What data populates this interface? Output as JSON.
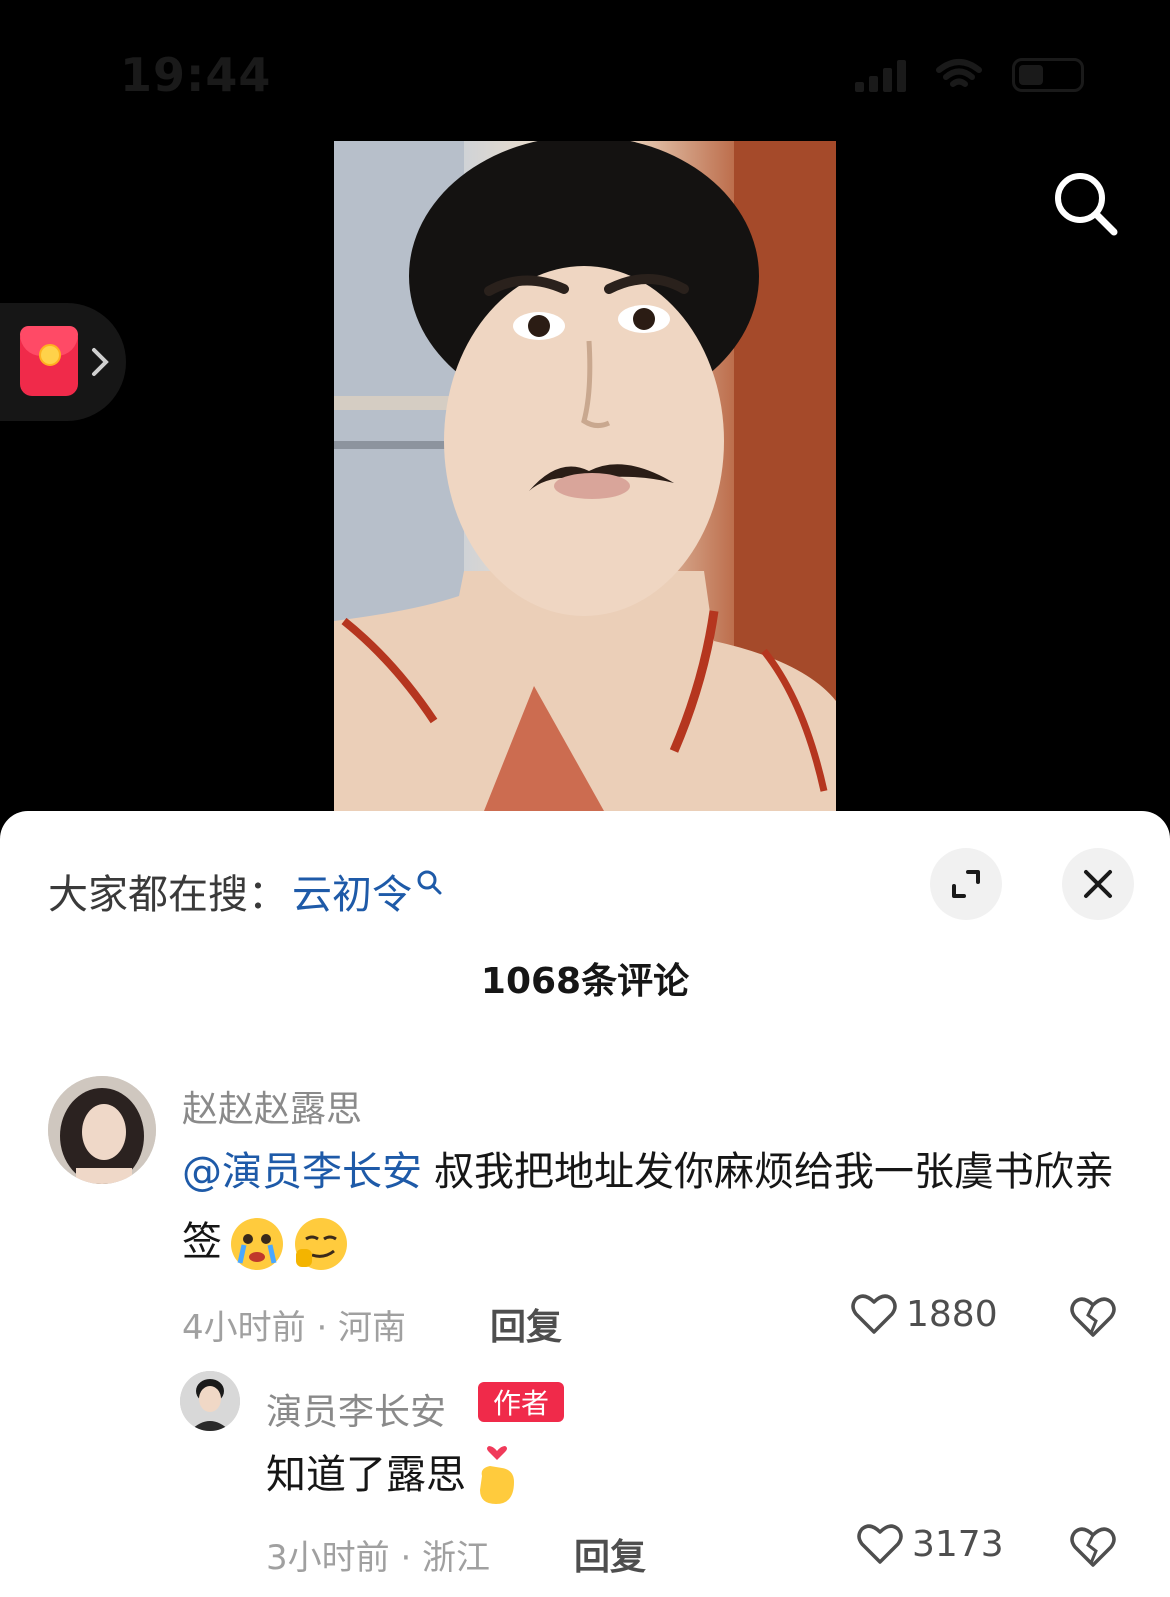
{
  "status_bar": {
    "time": "19:44"
  },
  "video": {
    "description_icon": "video-frame"
  },
  "comments_sheet": {
    "search_suggest": {
      "prefix": "大家都在搜：",
      "term": "云初令"
    },
    "comment_count_label": "1068条评论",
    "comments": [
      {
        "username": "赵赵赵露思",
        "mention": "@演员李长安",
        "text": "叔我把地址发你麻烦给我一张虞书欣亲签",
        "time_location": "4小时前 · 河南",
        "reply_label": "回复",
        "likes": "1880"
      },
      {
        "username": "演员李长安",
        "badge": "作者",
        "text": "知道了露思",
        "time_location": "3小时前 · 浙江",
        "reply_label": "回复",
        "likes": "3173"
      }
    ]
  },
  "colors": {
    "accent_red": "#f02a4a",
    "link_blue": "#1e5aa8"
  }
}
